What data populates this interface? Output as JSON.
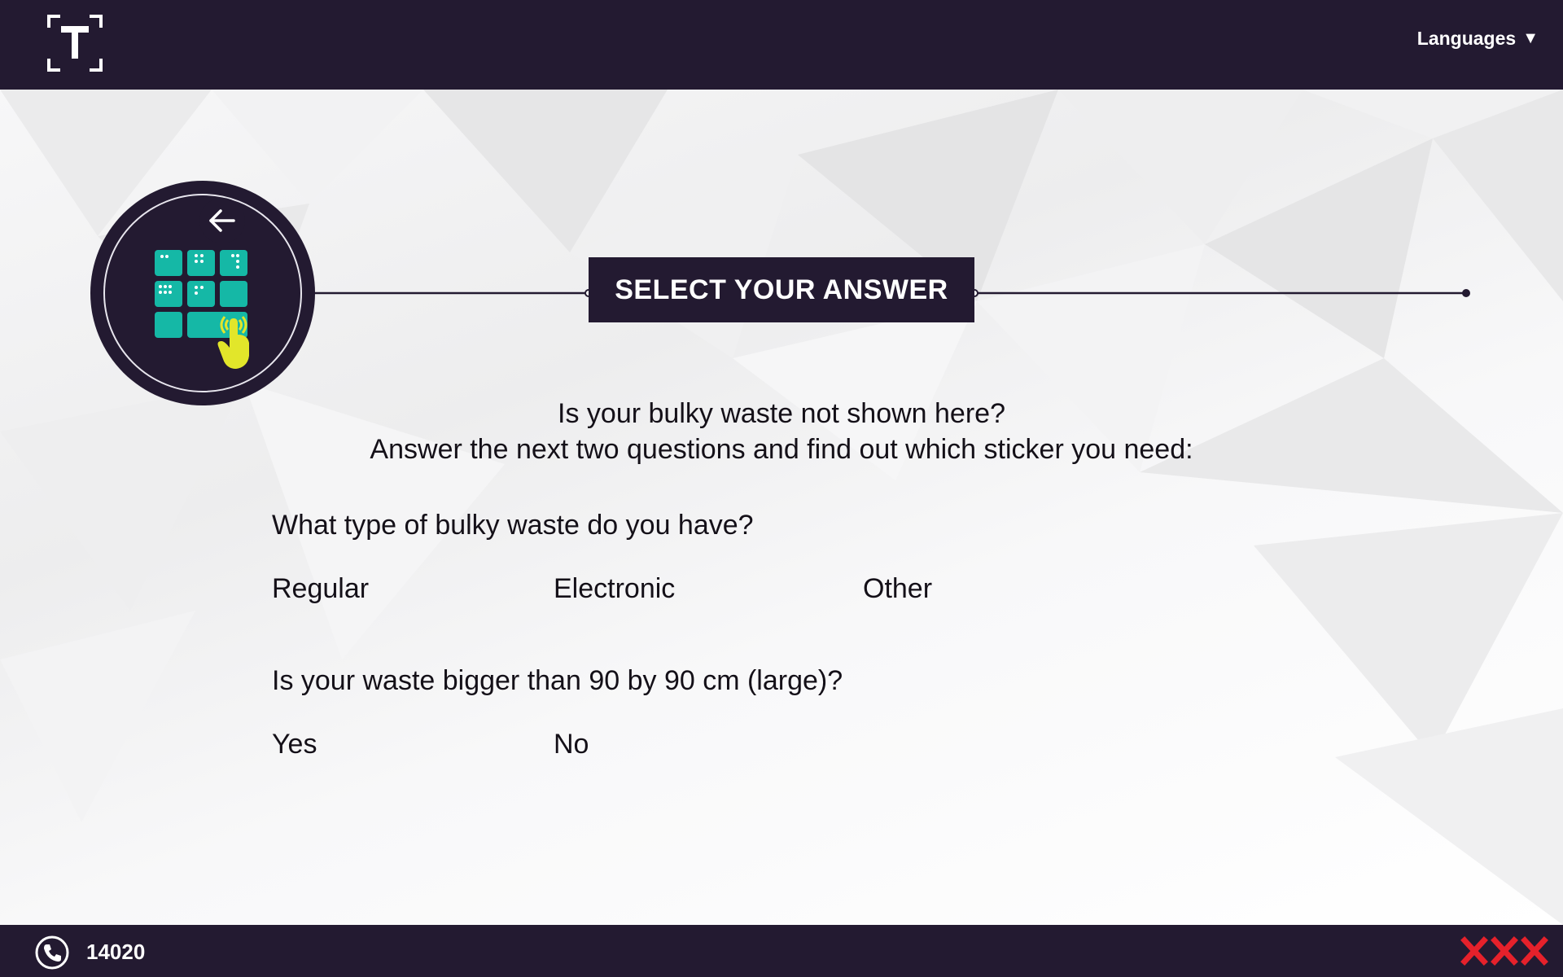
{
  "header": {
    "logo_icon": "t-bracket-logo",
    "languages_label": "Languages",
    "languages_caret": "▼"
  },
  "step": {
    "icon": "keypad-touch-icon",
    "back_icon": "arrow-left-icon",
    "title": "SELECT YOUR ANSWER"
  },
  "intro": {
    "line1": "Is your bulky waste not shown here?",
    "line2": "Answer the next two questions and find out which sticker you need:"
  },
  "question1": {
    "text": "What type of bulky waste do you have?",
    "options": [
      "Regular",
      "Electronic",
      "Other"
    ]
  },
  "question2": {
    "text": "Is your waste bigger than 90 by 90 cm (large)?",
    "options": [
      "Yes",
      "No"
    ]
  },
  "footer": {
    "phone_icon": "phone-icon",
    "phone_number": "14020",
    "brand_icon": "amsterdam-xxx-icon"
  },
  "colors": {
    "dark": "#231a31",
    "teal": "#15b8a6",
    "yellow": "#e2e62a",
    "red": "#e6212b"
  }
}
